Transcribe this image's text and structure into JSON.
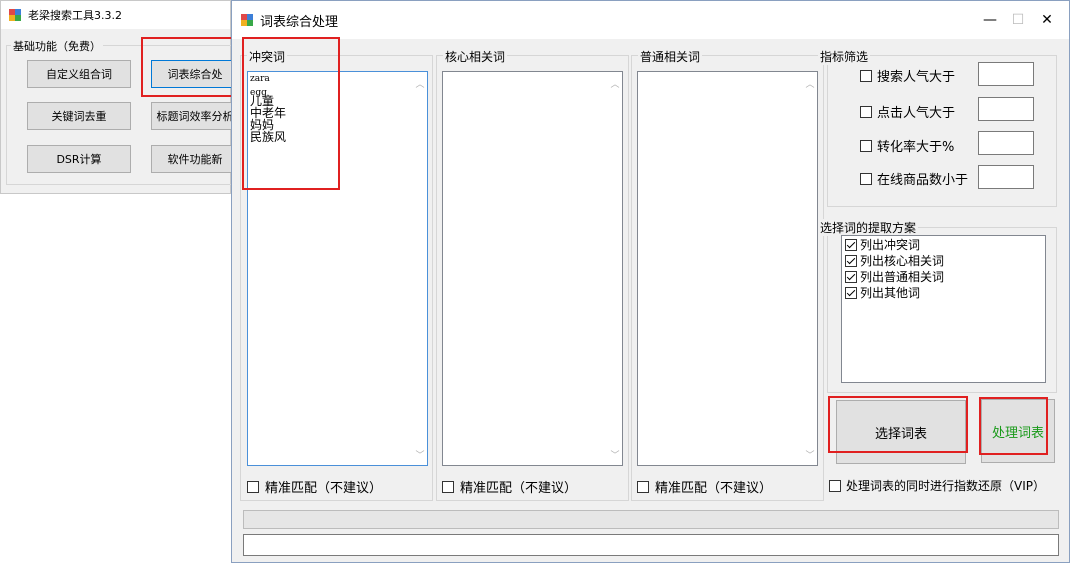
{
  "main_window": {
    "title": "老梁搜索工具3.3.2",
    "group_label": "基础功能（免费）",
    "buttons": {
      "custom_combo": "自定义组合词",
      "word_table": "词表综合处",
      "keyword_dedup": "关键词去重",
      "title_efficiency": "标题词效率分析",
      "dsr": "DSR计算",
      "software_features": "软件功能新"
    }
  },
  "dialog": {
    "title": "词表综合处理",
    "controls": {
      "minimize": "—",
      "maximize": "☐",
      "close": "✕"
    },
    "columns": [
      {
        "label": "冲突词",
        "items": [
          "zara",
          "egg",
          "儿童",
          "中老年",
          "妈妈",
          "民族风"
        ],
        "exact_match": "精准匹配（不建议）"
      },
      {
        "label": "核心相关词",
        "items": [],
        "exact_match": "精准匹配（不建议）"
      },
      {
        "label": "普通相关词",
        "items": [],
        "exact_match": "精准匹配（不建议）"
      }
    ],
    "filter": {
      "label": "指标筛选",
      "rows": [
        {
          "label": "搜索人气大于",
          "value": ""
        },
        {
          "label": "点击人气大于",
          "value": ""
        },
        {
          "label": "转化率大于%",
          "value": ""
        },
        {
          "label": "在线商品数小于",
          "value": ""
        }
      ]
    },
    "scheme": {
      "label": "选择词的提取方案",
      "items": [
        "列出冲突词",
        "列出核心相关词",
        "列出普通相关词",
        "列出其他词"
      ]
    },
    "select_button": "选择词表",
    "process_button": "处理词表",
    "restore_label": "处理词表的同时进行指数还原（VIP）",
    "status_text": "",
    "colors": {
      "process_text": "#1a9a1a",
      "highlight": "#e02020",
      "focus": "#0078d7"
    }
  }
}
